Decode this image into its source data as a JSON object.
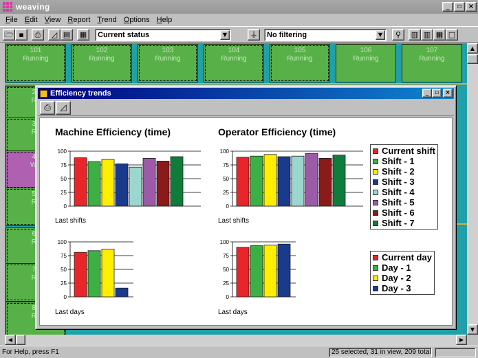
{
  "app": {
    "title": "weaving",
    "window_buttons": [
      "_",
      "▫",
      "×"
    ]
  },
  "menu": [
    {
      "label": "File",
      "key": "F"
    },
    {
      "label": "Edit",
      "key": "E"
    },
    {
      "label": "View",
      "key": "V"
    },
    {
      "label": "Report",
      "key": "R"
    },
    {
      "label": "Trend",
      "key": "T"
    },
    {
      "label": "Options",
      "key": "O"
    },
    {
      "label": "Help",
      "key": "H"
    }
  ],
  "toolbar": {
    "status_combo": "Current status",
    "filter_combo": "No filtering"
  },
  "machines": {
    "row1": [
      {
        "num": "101",
        "status": "Running"
      },
      {
        "num": "102",
        "status": "Running"
      },
      {
        "num": "103",
        "status": "Running"
      },
      {
        "num": "104",
        "status": "Running"
      },
      {
        "num": "105",
        "status": "Running"
      },
      {
        "num": "106",
        "status": "Running"
      },
      {
        "num": "107",
        "status": "Running"
      }
    ],
    "left_col": [
      {
        "num": "20",
        "status": "Ru"
      },
      {
        "num": "30",
        "status": "Ru"
      },
      {
        "num": "40",
        "status": "WE"
      },
      {
        "num": "50",
        "status": "Ru"
      },
      {
        "num": "60",
        "status": "Ru"
      },
      {
        "num": "70",
        "status": "Ru"
      },
      {
        "num": "80",
        "status": "Ru"
      }
    ]
  },
  "status_bar": {
    "help": "For Help, press F1",
    "counts": "25 selected, 31 in view, 209 total"
  },
  "trend_window": {
    "title": "Efficiency trends",
    "buttons": [
      "_",
      "▫",
      "×"
    ]
  },
  "colors": {
    "current": "#e8262a",
    "p1": "#3cb043",
    "p2": "#ffee00",
    "p3": "#1a3a8c",
    "p4": "#9cd6d0",
    "p5": "#9c5aa8",
    "p6": "#8b1a1a",
    "p7": "#107c3c"
  },
  "chart_data": [
    {
      "type": "bar",
      "title": "Machine Efficiency (time)",
      "xlabel": "Last shifts",
      "categories": [
        "Current shift",
        "Shift - 1",
        "Shift - 2",
        "Shift - 3",
        "Shift - 4",
        "Shift - 5",
        "Shift - 6",
        "Shift - 7"
      ],
      "values": [
        88,
        81,
        85,
        77,
        71,
        87,
        82,
        90
      ],
      "ylim": [
        0,
        100
      ],
      "yticks": [
        0,
        25,
        50,
        75,
        100
      ]
    },
    {
      "type": "bar",
      "title": "Operator Efficiency (time)",
      "xlabel": "Last shifts",
      "categories": [
        "Current shift",
        "Shift - 1",
        "Shift - 2",
        "Shift - 3",
        "Shift - 4",
        "Shift - 5",
        "Shift - 6",
        "Shift - 7"
      ],
      "values": [
        89,
        91,
        94,
        90,
        91,
        96,
        87,
        93
      ],
      "ylim": [
        0,
        100
      ],
      "yticks": [
        0,
        25,
        50,
        75,
        100
      ]
    },
    {
      "type": "bar",
      "title": "",
      "xlabel": "Last days",
      "categories": [
        "Current day",
        "Day - 1",
        "Day - 2",
        "Day - 3"
      ],
      "values": [
        81,
        84,
        87,
        16
      ],
      "ylim": [
        0,
        100
      ],
      "yticks": [
        0,
        25,
        50,
        75,
        100
      ]
    },
    {
      "type": "bar",
      "title": "",
      "xlabel": "Last days",
      "categories": [
        "Current day",
        "Day - 1",
        "Day - 2",
        "Day - 3"
      ],
      "values": [
        90,
        93,
        94,
        96
      ],
      "ylim": [
        0,
        100
      ],
      "yticks": [
        0,
        25,
        50,
        75,
        100
      ]
    }
  ],
  "legends": {
    "shifts": [
      "Current shift",
      "Shift - 1",
      "Shift - 2",
      "Shift - 3",
      "Shift - 4",
      "Shift - 5",
      "Shift - 6",
      "Shift - 7"
    ],
    "days": [
      "Current day",
      "Day - 1",
      "Day - 2",
      "Day - 3"
    ]
  }
}
